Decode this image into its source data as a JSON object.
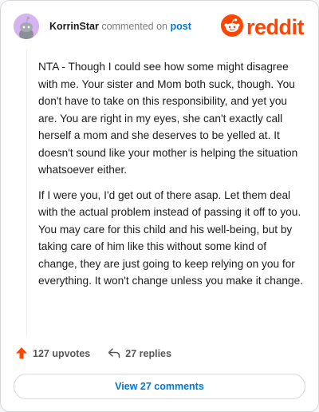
{
  "header": {
    "username": "KorrinStar",
    "commented_text": "commented on",
    "post_link": "post",
    "logo_text": "reddit"
  },
  "comment": {
    "paragraphs": [
      "NTA - Though I could see how some might disagree with me. Your sister and Mom both suck, though. You don't have to take on this responsibility, and yet you are. You are right in my eyes, she can't exactly call herself a mom and she deserves to be yelled at. It doesn't sound like your mother is helping the situation whatsoever either.",
      "If I were you, I'd get out of there asap. Let them deal with the actual problem instead of passing it off to you. You may care for this child and his well-being, but by taking care of him like this without some kind of change, they are just going to keep relying on you for everything. It won't change unless you make it change."
    ]
  },
  "actions": {
    "upvotes": "127 upvotes",
    "replies": "27 replies"
  },
  "view_button": "View 27 comments",
  "colors": {
    "brand": "#ff4500",
    "link": "#0079d3"
  },
  "icons": {
    "avatar": "snoo-avatar-icon",
    "logo": "reddit-snoo-icon",
    "upvote": "upvote-arrow-icon",
    "reply": "reply-arrow-icon"
  }
}
